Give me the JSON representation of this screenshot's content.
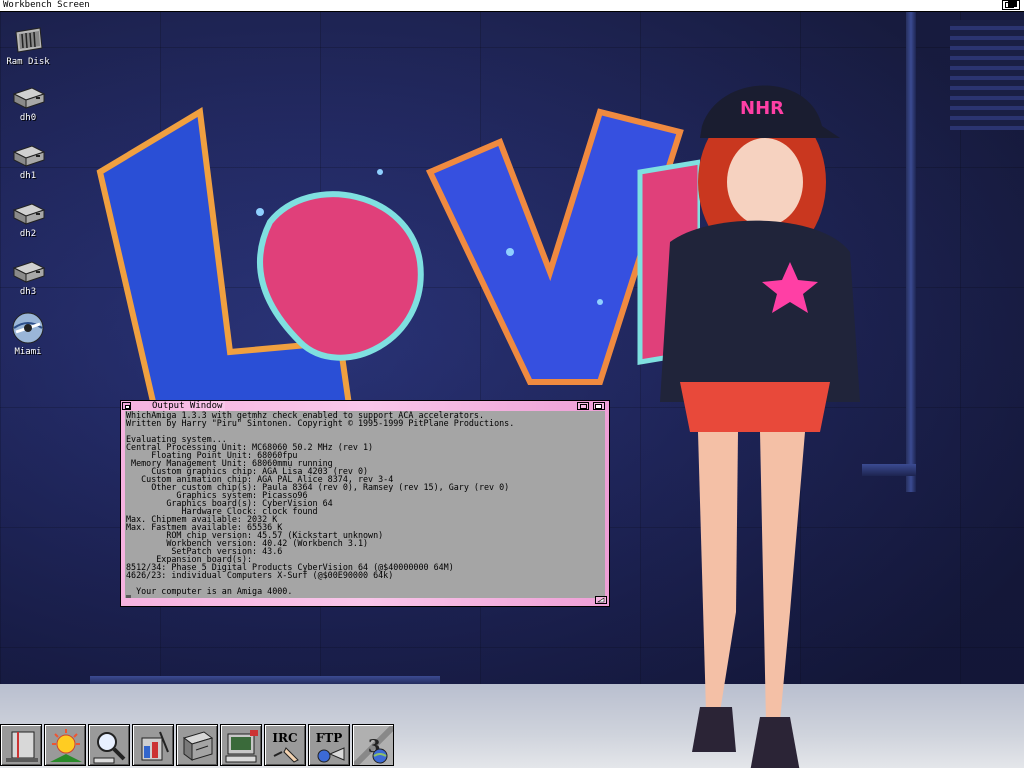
{
  "screen": {
    "title": "Workbench Screen"
  },
  "desktop_icons": [
    {
      "label": "Ram Disk",
      "icon": "ram-disk-icon"
    },
    {
      "label": "dh0",
      "icon": "hard-drive-icon"
    },
    {
      "label": "dh1",
      "icon": "hard-drive-icon"
    },
    {
      "label": "dh2",
      "icon": "hard-drive-icon"
    },
    {
      "label": "dh3",
      "icon": "hard-drive-icon"
    },
    {
      "label": "Miami",
      "icon": "miami-network-icon"
    }
  ],
  "output_window": {
    "title": "Output Window",
    "lines": [
      "WhichAmiga 1.3.3 with getmhz check enabled to support ACA accelerators.",
      "Written by Harry \"Piru\" Sintonen. Copyright © 1995-1999 PitPlane Productions.",
      "",
      "Evaluating system...",
      "Central Processing Unit: MC68060 50.2 MHz (rev 1)",
      "     Floating Point Unit: 68060fpu",
      " Memory Management Unit: 68060mmu running",
      "     Custom graphics chip: AGA Lisa 4203 (rev 0)",
      "   Custom animation chip: AGA PAL Alice 8374, rev 3-4",
      "     Other custom chip(s): Paula 8364 (rev 0), Ramsey (rev 15), Gary (rev 0)",
      "          Graphics system: Picasso96",
      "        Graphics board(s): CyberVision 64",
      "           Hardware Clock: clock found",
      "Max. Chipmem available: 2032 K",
      "Max. Fastmem available: 65536 K",
      "        ROM chip version: 45.57 (Kickstart unknown)",
      "        Workbench version: 40.42 (Workbench 3.1)",
      "         SetPatch version: 43.6",
      "      Expansion board(s):",
      "8512/34: Phase 5 Digital Products CyberVision 64 (@$40000000 64M)",
      "4626/23: individual Computers X-Surf (@$00E90000 64k)",
      "",
      "  Your computer is an Amiga 4000."
    ]
  },
  "dock": [
    {
      "name": "shell-dock-button",
      "icon": "shell-icon",
      "label": ""
    },
    {
      "name": "sun-dock-button",
      "icon": "sun-icon",
      "label": ""
    },
    {
      "name": "search-dock-button",
      "icon": "magnifier-icon",
      "label": ""
    },
    {
      "name": "paint-dock-button",
      "icon": "paint-icon",
      "label": ""
    },
    {
      "name": "disk-dock-button",
      "icon": "disk-icon",
      "label": ""
    },
    {
      "name": "terminal-dock-button",
      "icon": "computer-icon",
      "label": ""
    },
    {
      "name": "irc-dock-button",
      "icon": "irc-icon",
      "label": "IRC"
    },
    {
      "name": "ftp-dock-button",
      "icon": "ftp-icon",
      "label": "FTP"
    },
    {
      "name": "browser-dock-button",
      "icon": "browser-icon",
      "label": ""
    }
  ]
}
